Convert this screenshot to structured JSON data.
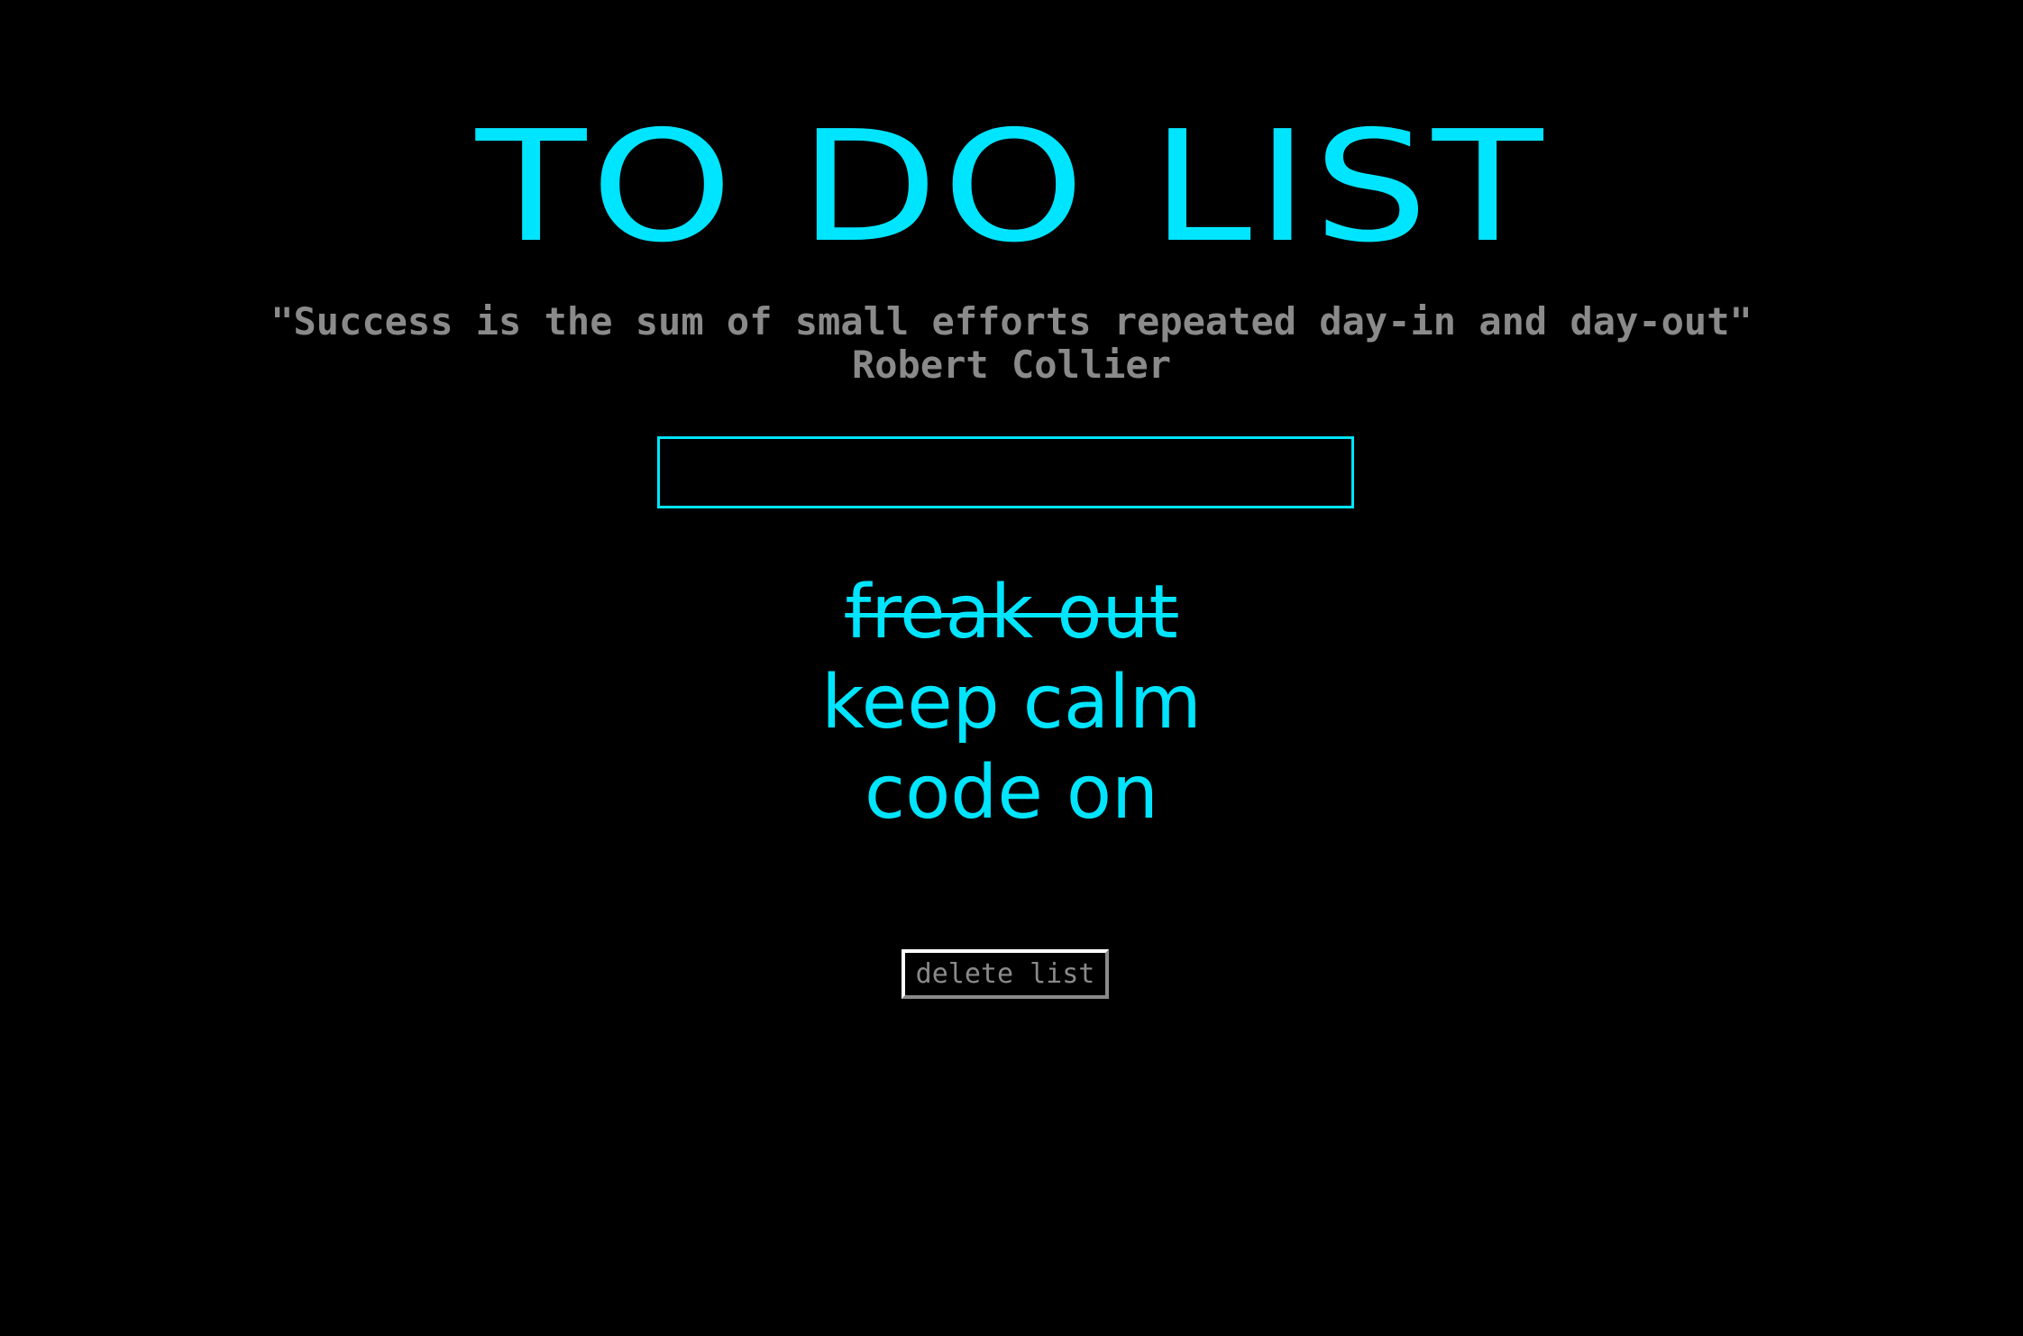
{
  "header": {
    "title": "TO DO LIST",
    "quote": "\"Success is the sum of small efforts repeated day-in and day-out\"",
    "author": "Robert Collier"
  },
  "input": {
    "value": "",
    "placeholder": ""
  },
  "tasks": [
    {
      "label": "freak out",
      "completed": true
    },
    {
      "label": "keep calm",
      "completed": false
    },
    {
      "label": "code on",
      "completed": false
    }
  ],
  "actions": {
    "delete_label": "delete list"
  },
  "colors": {
    "background": "#000000",
    "accent": "#00e5ff",
    "muted_text": "#8a8a8a"
  }
}
